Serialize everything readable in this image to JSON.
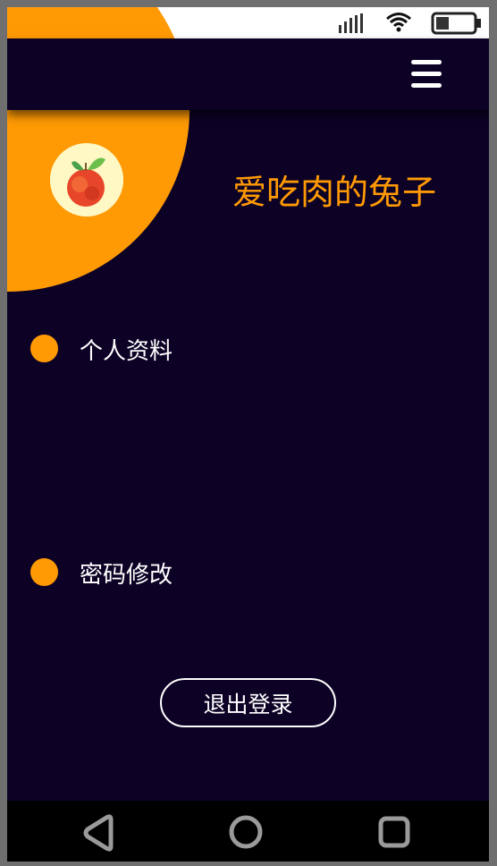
{
  "status_bar": {
    "signal_icon": "signal-bars-icon",
    "wifi_icon": "wifi-icon",
    "battery_icon": "battery-icon",
    "battery_level": 0.35
  },
  "header": {
    "menu_icon": "hamburger-menu-icon"
  },
  "profile": {
    "avatar_icon": "peach-fruit-avatar",
    "username": "爱吃肉的兔子"
  },
  "menu": {
    "items": [
      {
        "label": "个人资料"
      },
      {
        "label": "密码修改"
      }
    ]
  },
  "logout": {
    "label": "退出登录"
  },
  "nav_bar": {
    "back_icon": "back-triangle-icon",
    "home_icon": "home-circle-icon",
    "recents_icon": "recents-square-icon"
  },
  "colors": {
    "background": "#0d0225",
    "accent": "#ff9a05",
    "text": "#ffffff"
  }
}
